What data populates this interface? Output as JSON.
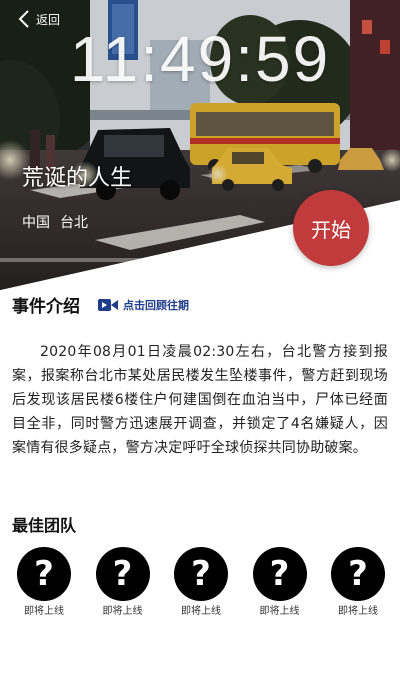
{
  "header": {
    "back_label": "返回",
    "clock": "11:49:59"
  },
  "case": {
    "title": "荒诞的人生",
    "location": {
      "country": "中国",
      "city": "台北"
    },
    "start_label": "开始"
  },
  "event": {
    "section_title": "事件介绍",
    "review_label": "点击回顾往期",
    "description": "2020年08月01日凌晨02:30左右，台北警方接到报案，报案称台北市某处居民楼发生坠楼事件，警方赶到现场后发现该居民楼6楼住户何建国倒在血泊当中，尸体已经面目全非，同时警方迅速展开调查，并锁定了4名嫌疑人，因案情有很多疑点，警方决定呼吁全球侦探共同协助破案。"
  },
  "team": {
    "title": "最佳团队",
    "members": [
      {
        "avatar": "?",
        "label": "即将上线"
      },
      {
        "avatar": "?",
        "label": "即将上线"
      },
      {
        "avatar": "?",
        "label": "即将上线"
      },
      {
        "avatar": "?",
        "label": "即将上线"
      },
      {
        "avatar": "?",
        "label": "即将上线"
      }
    ]
  },
  "colors": {
    "start_button": "#c13b3c",
    "review_link": "#1f3d8c"
  },
  "icons": {
    "back": "chevron-left-icon",
    "review": "video-camera-icon",
    "member": "question-mark-icon"
  }
}
